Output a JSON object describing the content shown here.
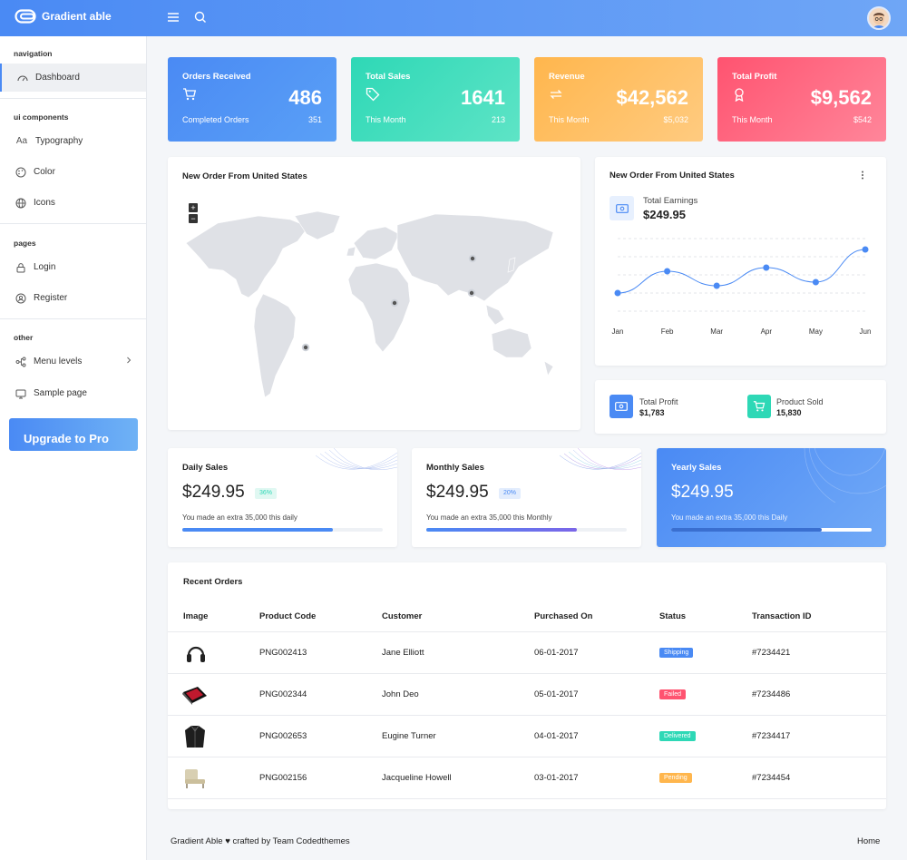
{
  "header": {
    "app_name": "Gradient able",
    "menu_icon": "menu-icon",
    "search_icon": "search-icon"
  },
  "sidebar": {
    "sections": [
      {
        "title": "navigation",
        "items": [
          {
            "label": "Dashboard",
            "icon": "dashboard-icon"
          }
        ]
      },
      {
        "title": "ui components",
        "items": [
          {
            "label": "Typography",
            "icon_text": "Aa"
          },
          {
            "label": "Color",
            "icon": "palette-icon"
          },
          {
            "label": "Icons",
            "icon": "globe-icon"
          }
        ]
      },
      {
        "title": "pages",
        "items": [
          {
            "label": "Login",
            "icon": "lock-icon"
          },
          {
            "label": "Register",
            "icon": "user-plus-icon"
          }
        ]
      },
      {
        "title": "other",
        "items": [
          {
            "label": "Menu levels",
            "icon": "tree-icon"
          },
          {
            "label": "Sample page",
            "icon": "monitor-icon"
          }
        ]
      }
    ],
    "upgrade_label": "Upgrade to Pro"
  },
  "stats": [
    {
      "title": "Orders Received",
      "value": "486",
      "sub": "Completed Orders",
      "sub_value": "351",
      "icon": "cart-icon"
    },
    {
      "title": "Total Sales",
      "value": "1641",
      "sub": "This Month",
      "sub_value": "213",
      "icon": "tag-icon"
    },
    {
      "title": "Revenue",
      "value": "$42,562",
      "sub": "This Month",
      "sub_value": "$5,032",
      "icon": "repeat-icon"
    },
    {
      "title": "Total Profit",
      "value": "$9,562",
      "sub": "This Month",
      "sub_value": "$542",
      "icon": "award-icon"
    }
  ],
  "map_card": {
    "title": "New Order From United States",
    "zoom_in": "+",
    "zoom_out": "−"
  },
  "earnings_card": {
    "title": "New Order From United States",
    "earnings_label": "Total Earnings",
    "earnings_value": "$249.95",
    "more_icon": "more-vertical-icon"
  },
  "chart_data": {
    "type": "line",
    "categories": [
      "Jan",
      "Feb",
      "Mar",
      "Apr",
      "May",
      "Jun"
    ],
    "series": [
      {
        "values": [
          25,
          55,
          35,
          60,
          40,
          85
        ]
      }
    ],
    "ylim": [
      0,
      100
    ],
    "grid": true,
    "color": "#4a8af4"
  },
  "mini_stats": [
    {
      "label": "Total Profit",
      "value": "$1,783",
      "color": "#4a8af4",
      "icon": "money-icon"
    },
    {
      "label": "Product Sold",
      "value": "15,830",
      "color": "#2ed8b6",
      "icon": "cart-icon"
    }
  ],
  "sales_cards": [
    {
      "title": "Daily Sales",
      "value": "$249.95",
      "badge": "36%",
      "note": "You made an extra 35,000 this daily",
      "progress": 0.75
    },
    {
      "title": "Monthly Sales",
      "value": "$249.95",
      "badge": "20%",
      "note": "You made an extra 35,000 this Monthly",
      "progress": 0.75
    },
    {
      "title": "Yearly Sales",
      "value": "$249.95",
      "note": "You made an extra 35,000 this Daily",
      "progress": 0.75
    }
  ],
  "orders": {
    "title": "Recent Orders",
    "columns": [
      "Image",
      "Product Code",
      "Customer",
      "Purchased On",
      "Status",
      "Transaction ID"
    ],
    "rows": [
      {
        "image": "headphones-image",
        "code": "PNG002413",
        "customer": "Jane Elliott",
        "date": "06-01-2017",
        "status": "Shipping",
        "status_color": "#4a8af4",
        "tid": "#7234421"
      },
      {
        "image": "phone-image",
        "code": "PNG002344",
        "customer": "John Deo",
        "date": "05-01-2017",
        "status": "Failed",
        "status_color": "#ff5370",
        "tid": "#7234486"
      },
      {
        "image": "jacket-image",
        "code": "PNG002653",
        "customer": "Eugine Turner",
        "date": "04-01-2017",
        "status": "Delivered",
        "status_color": "#2ed8b6",
        "tid": "#7234417"
      },
      {
        "image": "chair-image",
        "code": "PNG002156",
        "customer": "Jacqueline Howell",
        "date": "03-01-2017",
        "status": "Pending",
        "status_color": "#ffb64d",
        "tid": "#7234454"
      }
    ]
  },
  "footer": {
    "credit": "Gradient Able ♥ crafted by Team Codedthemes",
    "home": "Home"
  }
}
